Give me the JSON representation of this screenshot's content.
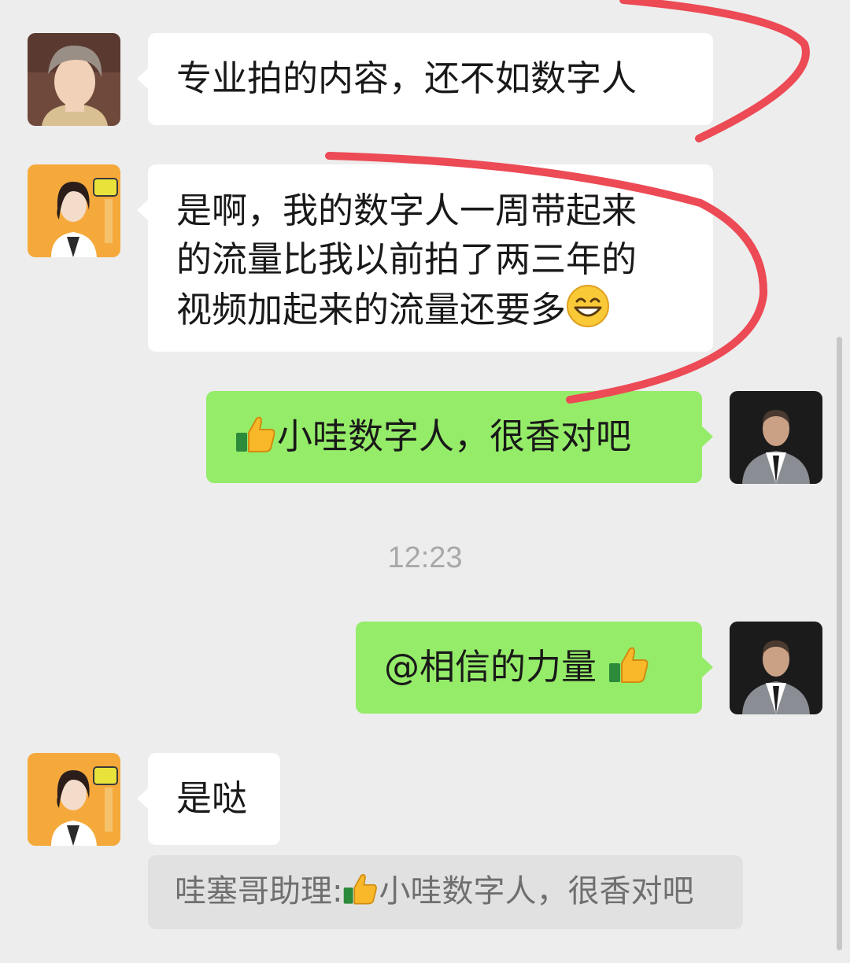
{
  "messages": [
    {
      "sender": "contact-1",
      "lines": [
        "专业拍的内容，还不如数字人"
      ]
    },
    {
      "sender": "contact-2",
      "lines": [
        "是啊，我的数字人一周带起来",
        "的流量比我以前拍了两三年的",
        "视频加起来的流量还要多"
      ],
      "trailing_emoji": "grinning-face"
    },
    {
      "sender": "self",
      "text": "小哇数字人，很香对吧",
      "leading_emoji": "thumbs-up"
    },
    {
      "sender": "self",
      "text": "@相信的力量",
      "trailing_emoji": "thumbs-up"
    },
    {
      "sender": "contact-2",
      "text": "是哒"
    }
  ],
  "timestamp": "12:23",
  "quote": {
    "sender_label": "哇塞哥助理:",
    "text": "小哇数字人，很香对吧",
    "emoji": "thumbs-up"
  },
  "colors": {
    "background": "#ededed",
    "incoming_bubble": "#ffffff",
    "outgoing_bubble": "#95ec69",
    "annotation_stroke": "#ec4a55",
    "avatar_contact_2_bg": "#f6a93b"
  }
}
